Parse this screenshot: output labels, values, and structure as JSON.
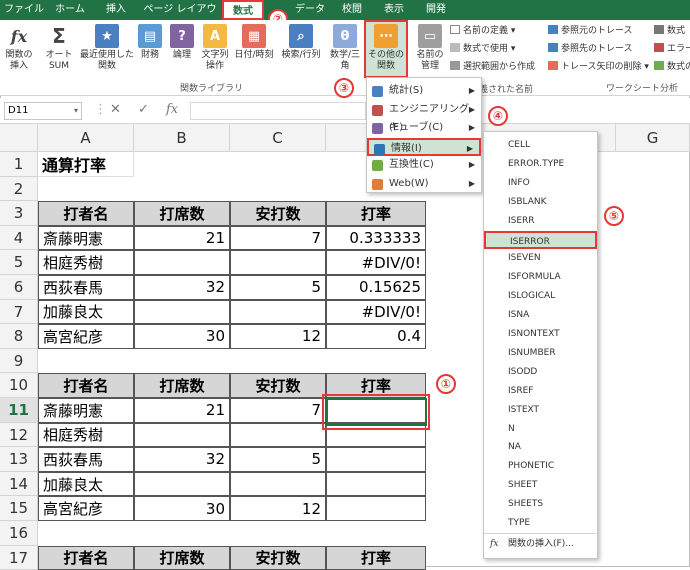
{
  "tabs": [
    "ファイル",
    "ホーム",
    "挿入",
    "ページ レイアウト",
    "数式",
    "データ",
    "校閲",
    "表示",
    "開発"
  ],
  "ribbon": {
    "insert_function": "関数の\n挿入",
    "autosum": "オート\nSUM",
    "recent": "最近使用した\n関数",
    "financial": "財務",
    "logical": "論理",
    "text": "文字列\n操作",
    "datetime": "日付/時刻",
    "lookup": "検索/行列",
    "math": "数学/三角",
    "more_functions": "その他の\n関数",
    "name_manager": "名前の\n管理",
    "define_name": "名前の定義",
    "use_in_formula": "数式で使用",
    "create_from_selection": "選択範囲から作成",
    "trace_precedents": "参照元のトレース",
    "trace_dependents": "参照先のトレース",
    "remove_arrows": "トレース矢印の削除",
    "show_formulas": "数式",
    "error_check": "エラー",
    "evaluate": "数式の検証",
    "group_function_library": "関数ライブラリ",
    "group_defined_names": "定義された名前",
    "group_formula_auditing": "ワークシート分析"
  },
  "formula_bar": {
    "name_box": "D11",
    "fx": "fx"
  },
  "grid": {
    "columns": [
      "A",
      "B",
      "C",
      "D",
      "E",
      "F",
      "G"
    ],
    "rows": [
      "1",
      "2",
      "3",
      "4",
      "5",
      "6",
      "7",
      "8",
      "9",
      "10",
      "11",
      "12",
      "13",
      "14",
      "15",
      "16",
      "17"
    ],
    "title": "通算打率",
    "headers": [
      "打者名",
      "打席数",
      "安打数",
      "打率"
    ],
    "table1": [
      [
        "斎藤明憲",
        "21",
        "7",
        "0.333333"
      ],
      [
        "相庭秀樹",
        "",
        "",
        "#DIV/0!"
      ],
      [
        "西荻春馬",
        "32",
        "5",
        "0.15625"
      ],
      [
        "加藤良太",
        "",
        "",
        "#DIV/0!"
      ],
      [
        "高宮紀彦",
        "30",
        "12",
        "0.4"
      ]
    ],
    "table2": [
      [
        "斎藤明憲",
        "21",
        "7",
        ""
      ],
      [
        "相庭秀樹",
        "",
        "",
        ""
      ],
      [
        "西荻春馬",
        "32",
        "5",
        ""
      ],
      [
        "加藤良太",
        "",
        "",
        ""
      ],
      [
        "高宮紀彦",
        "30",
        "12",
        ""
      ]
    ]
  },
  "menu_more": [
    {
      "label": "統計(S)",
      "icon_color": "#4a7fc1"
    },
    {
      "label": "エンジニアリング(E)",
      "icon_color": "#c0504d"
    },
    {
      "label": "キューブ(C)",
      "icon_color": "#8064a2"
    },
    {
      "label": "情報(I)",
      "icon_color": "#2e75b6"
    },
    {
      "label": "互換性(C)",
      "icon_color": "#70ad47"
    },
    {
      "label": "Web(W)",
      "icon_color": "#e07b39"
    }
  ],
  "menu_info": [
    "CELL",
    "ERROR.TYPE",
    "INFO",
    "ISBLANK",
    "ISERR",
    "ISERROR",
    "ISEVEN",
    "ISFORMULA",
    "ISLOGICAL",
    "ISNA",
    "ISNONTEXT",
    "ISNUMBER",
    "ISODD",
    "ISREF",
    "ISTEXT",
    "N",
    "NA",
    "PHONETIC",
    "SHEET",
    "SHEETS",
    "TYPE"
  ],
  "menu_info_insert": "関数の挿入(F)...",
  "markers": [
    "①",
    "②",
    "③",
    "④",
    "⑤"
  ],
  "colors": {
    "accent": "#217346",
    "annotation": "#e53935"
  }
}
